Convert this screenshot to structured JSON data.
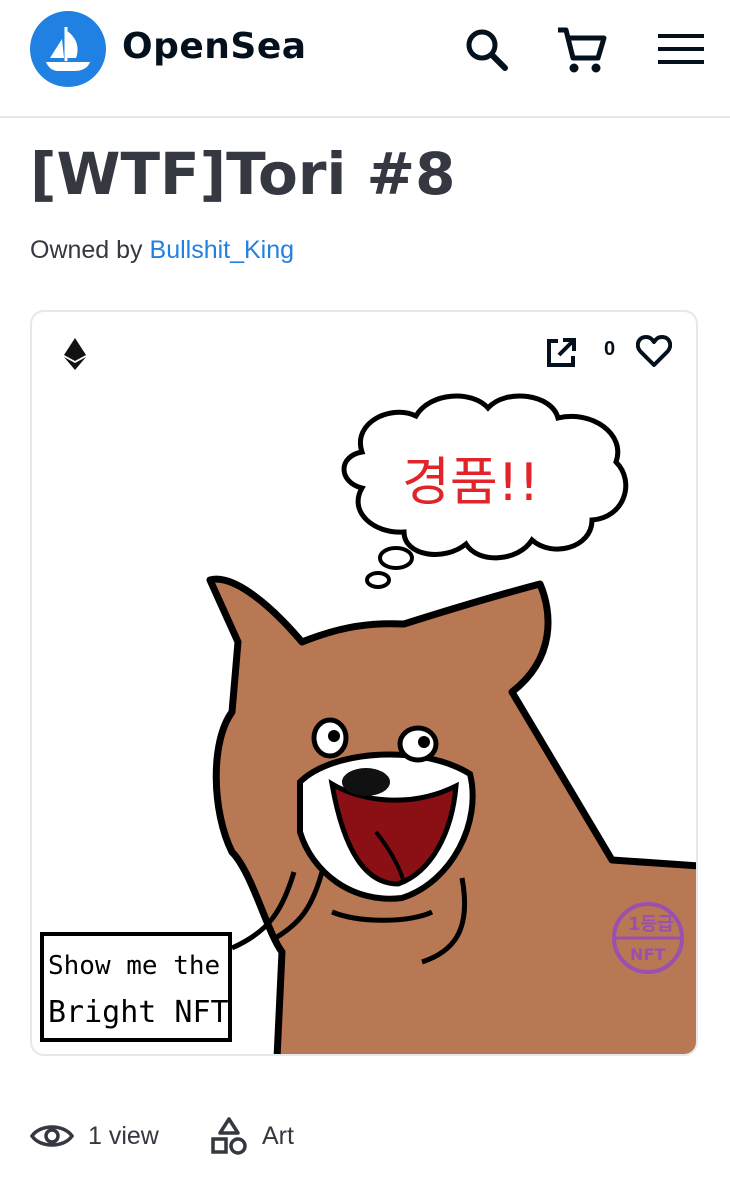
{
  "header": {
    "brand": "OpenSea",
    "logo_icon": "opensea-ship-icon",
    "search_icon": "search-icon",
    "cart_icon": "cart-icon",
    "menu_icon": "hamburger-menu-icon"
  },
  "asset": {
    "title": "[WTF]Tori #8",
    "owned_by_label": "Owned by",
    "owner": "Bullshit_King",
    "favorites_count": "0",
    "chain_icon": "ethereum-icon",
    "artwork": {
      "thought_text": "경품!!",
      "sign_line1": "Show me the",
      "sign_line2": "Bright NFT",
      "stamp_top": "1등급",
      "stamp_bottom": "NFT"
    }
  },
  "stats": {
    "views": "1 view",
    "category": "Art"
  },
  "colors": {
    "accent": "#2081e2",
    "title": "#353840",
    "border": "#e5e8eb",
    "dog_fill": "#b87853",
    "stamp": "#9b4fb0"
  }
}
